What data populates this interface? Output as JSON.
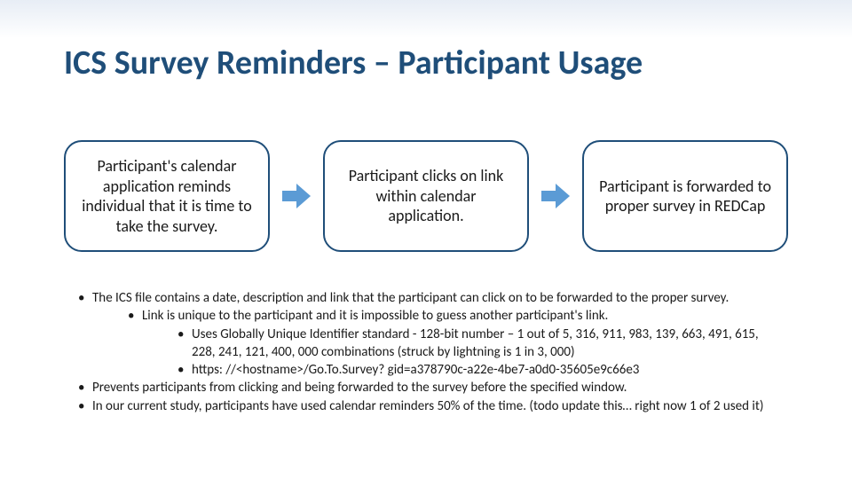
{
  "title": "ICS Survey Reminders – Participant Usage",
  "flow": {
    "step1": "Participant's calendar application reminds individual that it is time to take the survey.",
    "step2": "Participant clicks on link within calendar application.",
    "step3": "Participant is forwarded to proper survey in REDCap"
  },
  "bullets": {
    "b1": "The ICS file contains a date, description and link that the participant can click on to be forwarded to the proper survey.",
    "b1a": "Link is unique to the participant and it is impossible to guess another participant's link.",
    "b1a1": "Uses Globally Unique Identifier standard - 128-bit number – 1 out of 5, 316, 911, 983, 139, 663, 491, 615, 228, 241, 121, 400, 000 combinations (struck by lightning is 1 in 3, 000)",
    "b1a2": "https: //<hostname>/Go.To.Survey? gid=a378790c-a22e-4be7-a0d0-35605e9c66e3",
    "b2": "Prevents participants from clicking and being forwarded to the survey before the specified window.",
    "b3": "In our current study, participants have used calendar reminders 50% of the time.  (todo update this… right now 1 of 2 used it)"
  }
}
